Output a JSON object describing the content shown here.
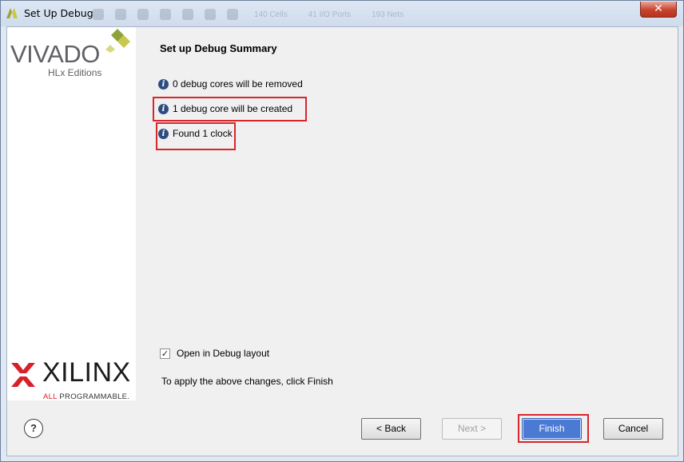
{
  "window": {
    "title": "Set Up Debug",
    "close_label": "✕",
    "background_toolbar": [
      "140 Cells",
      "41 I/O Ports",
      "193 Nets"
    ]
  },
  "brand": {
    "vivado": "VIVADO",
    "hlx": "HLx Editions",
    "xilinx": "XILINX",
    "all": "ALL",
    "programmable": "PROGRAMMABLE."
  },
  "summary": {
    "title": "Set up Debug Summary",
    "items": [
      {
        "icon": "info-icon",
        "text": "0 debug cores will be removed"
      },
      {
        "icon": "info-icon",
        "text": "1 debug core will be created"
      },
      {
        "icon": "info-icon",
        "text": "Found 1 clock"
      }
    ]
  },
  "options": {
    "open_debug_layout_label": "Open in Debug layout",
    "open_debug_layout_checked": true
  },
  "apply_text": "To apply the above changes, click Finish",
  "buttons": {
    "help": "?",
    "back": "< Back",
    "next": "Next >",
    "finish": "Finish",
    "cancel": "Cancel"
  },
  "colors": {
    "highlight": "#d8262c",
    "finish_blue": "#4a7ad3",
    "info_icon": "#2e4d7f"
  }
}
